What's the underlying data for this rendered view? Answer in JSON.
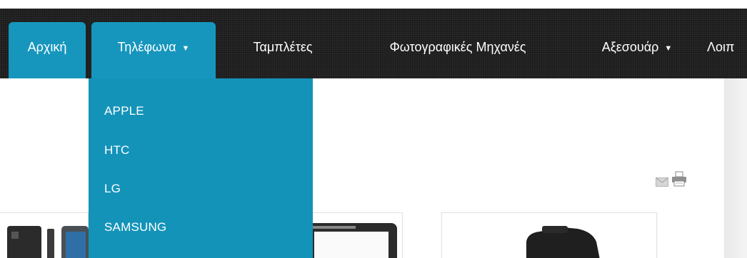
{
  "nav": {
    "items": [
      {
        "label": "Αρχική"
      },
      {
        "label": "Τηλέφωνα",
        "caret": "▼"
      },
      {
        "label": "Ταμπλέτες"
      },
      {
        "label": "Φωτογραφικές Μηχανές"
      },
      {
        "label": "Αξεσουάρ",
        "caret": "▼"
      },
      {
        "label": "Λοιπ"
      }
    ]
  },
  "dropdown": {
    "items": [
      "APPLE",
      "HTC",
      "LG",
      "SAMSUNG"
    ]
  },
  "icons": {
    "email": "email-icon",
    "print": "print-icon"
  },
  "colors": {
    "tab_active": "#1696bd",
    "dropdown_bg": "#1493b9",
    "navbar_bg": "#1c1c1c"
  }
}
